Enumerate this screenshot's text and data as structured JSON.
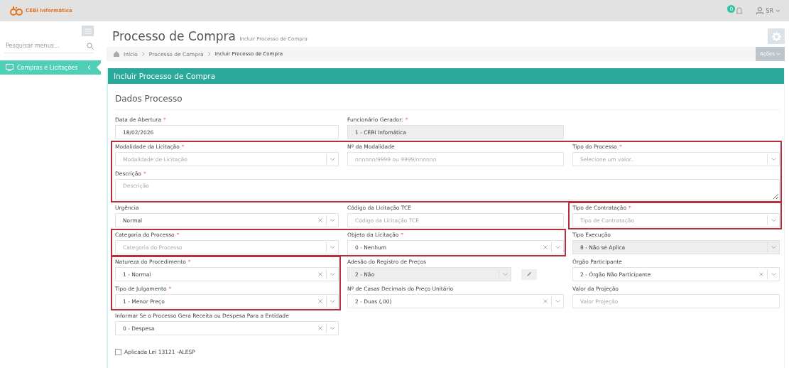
{
  "topbar": {
    "logo_text": "CEBI Informática",
    "notification_badge": "0",
    "user": "SR"
  },
  "sidebar": {
    "search_placeholder": "Pesquisar menus...",
    "items": [
      {
        "label": "Compras e Licitações",
        "selected": true
      }
    ]
  },
  "page": {
    "title": "Processo de Compra",
    "subtitle": "Incluir Processo de Compra",
    "breadcrumb": [
      "Início",
      "Processo de Compra",
      "Incluir Processo de Compra"
    ],
    "actions_button": "Ações"
  },
  "panel": {
    "title": "Incluir Processo de Compra",
    "section": "Dados Processo",
    "rows": [
      [
        {
          "label": "Data de Abertura",
          "mark": "*",
          "kind": "input",
          "value": "18/02/2026"
        },
        {
          "label": "Funcionário Gerador:",
          "mark": "*",
          "kind": "input",
          "value": "1 - CEBI Infomática",
          "disabled": true
        }
      ],
      [
        {
          "label": "Modalidade da Licitação",
          "mark": "*",
          "kind": "select",
          "placeholder": "Modalidade de Licitação",
          "framed": true,
          "frame_start": true
        },
        {
          "label": "Nº da Modalidade",
          "kind": "input",
          "placeholder": "nnnnnn/9999 ou 9999/nnnnnn",
          "framed": true
        },
        {
          "label": "Tipo do Processo",
          "mark": "*",
          "kind": "select",
          "placeholder": "Selecione um valor..",
          "framed": true
        }
      ],
      [
        {
          "label": "Descrição",
          "mark": "*",
          "kind": "textarea",
          "placeholder": "Descrição",
          "framed": true
        }
      ],
      [
        {
          "label": "Urgência",
          "kind": "select",
          "value": "Normal",
          "clearable": true
        },
        {
          "label": "Código da Licitação TCE",
          "kind": "input",
          "placeholder": "Código da Licitação TCE"
        },
        {
          "label": "Tipo de Contratação",
          "mark": "*",
          "kind": "select",
          "placeholder": "Tipo de Contratação",
          "framed": true,
          "frame_start": true
        }
      ],
      [
        {
          "label": "Categoria do Processo",
          "mark": "*",
          "kind": "select",
          "placeholder": "Categoria do Processo",
          "framed": true,
          "frame_start": true
        },
        {
          "label": "Objeto da Licitação",
          "mark": "*",
          "kind": "select",
          "value": "0 - Nenhum",
          "clearable": true,
          "framed": true
        },
        {
          "label": "Tipo Execução",
          "kind": "select",
          "value": "8 - Não se Aplica",
          "disabled": true
        }
      ],
      [
        {
          "label": "Natureza do Procedimento",
          "mark": "*",
          "kind": "select",
          "value": "1 - Normal",
          "clearable": true,
          "framed": true,
          "frame_start": true
        },
        {
          "label": "Adesão do Registro de Preços",
          "kind": "select",
          "value": "2 - Não",
          "disabled": true,
          "edit_button": true
        },
        {
          "label": "Órgão Participante",
          "kind": "select",
          "value": "2 - Órgão Não Participante",
          "clearable": true
        }
      ],
      [
        {
          "label": "Tipo de Julgamento",
          "mark": "*",
          "kind": "select",
          "value": "1 - Menor Preço",
          "clearable": true,
          "framed": true
        },
        {
          "label": "Nº de Casas Decimais do Preço Unitário",
          "kind": "select",
          "value": "2 - Duas (,00)",
          "clearable": true
        },
        {
          "label": "Valor da Projeção",
          "kind": "input",
          "placeholder": "Valor Projeção"
        }
      ],
      [
        {
          "label": "Informar Se o Processo Gera Receita ou Despesa Para a Entidade",
          "kind": "select",
          "value": "0 - Despesa",
          "clearable": true
        }
      ]
    ],
    "checkbox": {
      "label": "Aplicada Lei 13121 -ALESP",
      "checked": false
    }
  }
}
